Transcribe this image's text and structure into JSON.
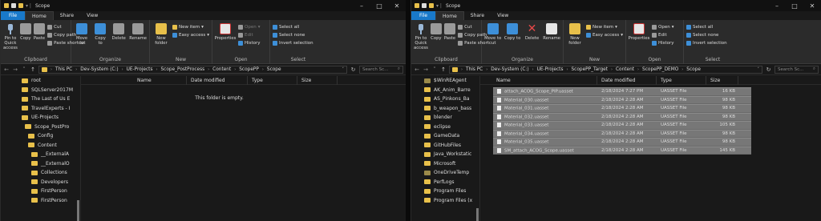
{
  "left": {
    "title": "Scope",
    "tabs": {
      "file": "File",
      "home": "Home",
      "share": "Share",
      "view": "View"
    },
    "ribbon": {
      "clipboard": {
        "label": "Clipboard",
        "pin": "Pin to Quick access",
        "copy": "Copy",
        "paste": "Paste",
        "cut": "Cut",
        "copy_path": "Copy path",
        "paste_shortcut": "Paste shortcut"
      },
      "organize": {
        "label": "Organize",
        "move_to": "Move to",
        "copy_to": "Copy to",
        "delete": "Delete",
        "rename": "Rename"
      },
      "new": {
        "label": "New",
        "new_folder": "New folder",
        "new_item": "New item",
        "easy_access": "Easy access"
      },
      "open": {
        "label": "Open",
        "properties": "Properties",
        "open": "Open",
        "edit": "Edit",
        "history": "History"
      },
      "select": {
        "label": "Select",
        "select_all": "Select all",
        "select_none": "Select none",
        "invert": "Invert selection"
      }
    },
    "breadcrumb": [
      "This PC",
      "Dev-System (C:)",
      "UE-Projects",
      "Scope_PostProcess",
      "Content",
      "ScopePP",
      "Scope"
    ],
    "search_placeholder": "Search Sc...",
    "columns": {
      "name": "Name",
      "date": "Date modified",
      "type": "Type",
      "size": "Size"
    },
    "empty_message": "This folder is empty.",
    "nav_items": [
      {
        "label": "root"
      },
      {
        "label": "SQLServer2017M"
      },
      {
        "label": "The Last of Us E"
      },
      {
        "label": "TravelExperts - I"
      },
      {
        "label": "UE-Projects"
      },
      {
        "label": "Scope_PostPro"
      },
      {
        "label": "Config"
      },
      {
        "label": "Content"
      },
      {
        "label": "__ExternalA"
      },
      {
        "label": "__ExternalO"
      },
      {
        "label": "Collections"
      },
      {
        "label": "Developers"
      },
      {
        "label": "FirstPerson"
      },
      {
        "label": "FirstPerson"
      }
    ]
  },
  "right": {
    "title": "Scope",
    "tabs": {
      "file": "File",
      "home": "Home",
      "share": "Share",
      "view": "View"
    },
    "ribbon": {
      "clipboard": {
        "label": "Clipboard",
        "pin": "Pin to Quick access",
        "copy": "Copy",
        "paste": "Paste",
        "cut": "Cut",
        "copy_path": "Copy path",
        "paste_shortcut": "Paste shortcut"
      },
      "organize": {
        "label": "Organize",
        "move_to": "Move to",
        "copy_to": "Copy to",
        "delete": "Delete",
        "rename": "Rename"
      },
      "new": {
        "label": "New",
        "new_folder": "New folder",
        "new_item": "New item",
        "easy_access": "Easy access"
      },
      "open": {
        "label": "Open",
        "properties": "Properties",
        "open": "Open",
        "edit": "Edit",
        "history": "History"
      },
      "select": {
        "label": "Select",
        "select_all": "Select all",
        "select_none": "Select none",
        "invert": "Invert selection"
      }
    },
    "breadcrumb": [
      "This PC",
      "Dev-System (C:)",
      "UE-Projects",
      "ScopePP_Target",
      "Content",
      "ScopePP_DEMO",
      "Scope"
    ],
    "search_placeholder": "Search Sc...",
    "columns": {
      "name": "Name",
      "date": "Date modified",
      "type": "Type",
      "size": "Size"
    },
    "files": [
      {
        "name": "attach_ACOG_Scope_PIP.uasset",
        "date": "2/18/2024 7:27 PM",
        "type": "UASSET File",
        "size": "16 KB"
      },
      {
        "name": "Material_030.uasset",
        "date": "2/18/2024 2:28 AM",
        "type": "UASSET File",
        "size": "98 KB"
      },
      {
        "name": "Material_031.uasset",
        "date": "2/18/2024 2:28 AM",
        "type": "UASSET File",
        "size": "98 KB"
      },
      {
        "name": "Material_032.uasset",
        "date": "2/18/2024 2:28 AM",
        "type": "UASSET File",
        "size": "98 KB"
      },
      {
        "name": "Material_033.uasset",
        "date": "2/18/2024 2:28 AM",
        "type": "UASSET File",
        "size": "105 KB"
      },
      {
        "name": "Material_034.uasset",
        "date": "2/18/2024 2:28 AM",
        "type": "UASSET File",
        "size": "98 KB"
      },
      {
        "name": "Material_035.uasset",
        "date": "2/18/2024 2:28 AM",
        "type": "UASSET File",
        "size": "98 KB"
      },
      {
        "name": "SM_attach_ACOG_Scope.uasset",
        "date": "2/18/2024 2:28 AM",
        "type": "UASSET File",
        "size": "145 KB"
      }
    ],
    "nav_items": [
      {
        "label": "$WinREAgent"
      },
      {
        "label": "AK_Anim_Barre"
      },
      {
        "label": "AS_Pinkons_Ba"
      },
      {
        "label": "b_weapon_bass"
      },
      {
        "label": "blender"
      },
      {
        "label": "eclipse"
      },
      {
        "label": "GameData"
      },
      {
        "label": "GitHubFiles"
      },
      {
        "label": "Java_Workstatic"
      },
      {
        "label": "Microsoft"
      },
      {
        "label": "OneDriveTemp"
      },
      {
        "label": "PerfLogs"
      },
      {
        "label": "Program Files"
      },
      {
        "label": "Program Files (x"
      }
    ]
  }
}
